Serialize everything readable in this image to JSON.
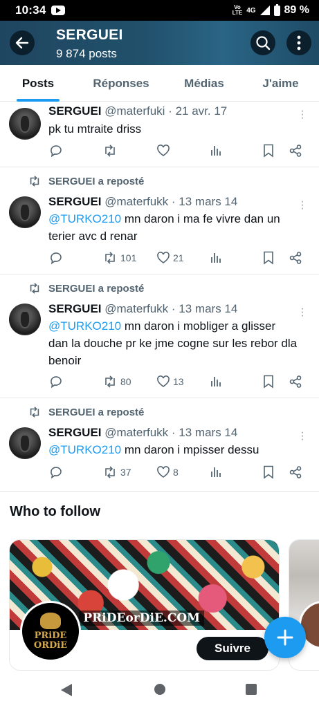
{
  "status_bar": {
    "time": "10:34",
    "volte": "Vo\nLTE",
    "network": "4G",
    "battery": "89 %"
  },
  "header": {
    "title": "SERGUEI",
    "posts_count": "9 874 posts"
  },
  "tabs": [
    {
      "label": "Posts",
      "active": true
    },
    {
      "label": "Réponses",
      "active": false
    },
    {
      "label": "Médias",
      "active": false
    },
    {
      "label": "J'aime",
      "active": false
    }
  ],
  "posts": [
    {
      "reposted_by": "",
      "name": "SERGUEI",
      "handle": "@materfuki",
      "date": "21 avr. 17",
      "mention": "",
      "text": "pk tu mtraite driss",
      "retweets": "",
      "likes": ""
    },
    {
      "reposted_by": "SERGUEI a reposté",
      "name": "SERGUEI",
      "handle": "@materfukk",
      "date": "13 mars 14",
      "mention": "@TURKO210",
      "text": " mn daron i ma fe vivre dan un terier avc d renar",
      "retweets": "101",
      "likes": "21"
    },
    {
      "reposted_by": "SERGUEI a reposté",
      "name": "SERGUEI",
      "handle": "@materfukk",
      "date": "13 mars 14",
      "mention": "@TURKO210",
      "text": " mn daron i mobliger a glisser dan la douche pr ke jme cogne sur les rebor dla benoir",
      "retweets": "80",
      "likes": "13"
    },
    {
      "reposted_by": "SERGUEI a reposté",
      "name": "SERGUEI",
      "handle": "@materfukk",
      "date": "13 mars 14",
      "mention": "@TURKO210",
      "text": " mn daron i mpisser dessu",
      "retweets": "37",
      "likes": "8"
    }
  ],
  "who_to_follow": {
    "title": "Who to follow",
    "card": {
      "banner_text": "PRiDEorDiE.COM",
      "avatar_text": "PRiDE\nORDiE",
      "follow_label": "Suivre"
    }
  },
  "colors": {
    "accent": "#1d9bf0",
    "header_bg": "#21506b",
    "text": "#0f1419",
    "muted": "#536471"
  },
  "icons": [
    "back-arrow-icon",
    "search-icon",
    "more-vertical-icon",
    "reply-icon",
    "repost-icon",
    "like-icon",
    "views-icon",
    "bookmark-icon",
    "share-icon",
    "compose-plus-icon"
  ]
}
